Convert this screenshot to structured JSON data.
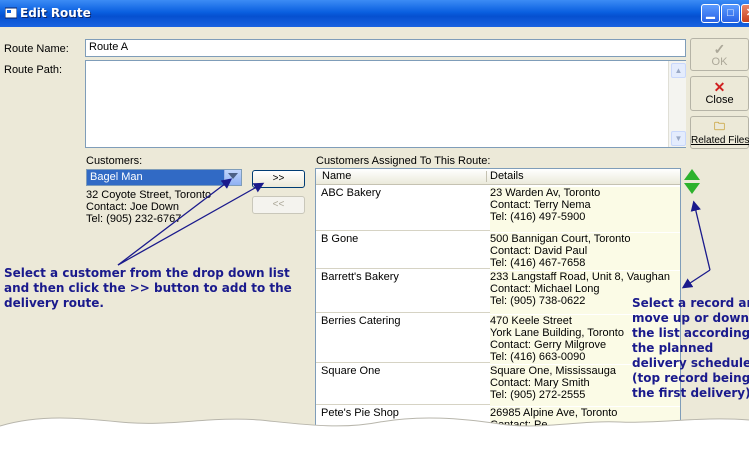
{
  "window": {
    "title": "Edit Route"
  },
  "form": {
    "route_name_label": "Route Name:",
    "route_name_value": "Route A",
    "route_path_label": "Route Path:",
    "route_path_value": ""
  },
  "side_buttons": {
    "ok": "OK",
    "close": "Close",
    "related_files": "Related Files"
  },
  "customers": {
    "label": "Customers:",
    "selected": "Bagel Man",
    "address": "32 Coyote Street, Toronto",
    "contact": "Contact: Joe Down",
    "tel": "Tel: (905) 232-6767",
    "add_label": ">>",
    "remove_label": "<<"
  },
  "assigned": {
    "label": "Customers Assigned To This Route:",
    "columns": [
      "Name",
      "Details"
    ],
    "rows": [
      {
        "name": "ABC Bakery",
        "details": [
          "23 Warden Av, Toronto",
          "Contact: Terry Nema",
          "Tel: (416) 497-5900"
        ]
      },
      {
        "name": "B Gone",
        "details": [
          "500 Bannigan Court, Toronto",
          "Contact: David Paul",
          "Tel: (416) 467-7658"
        ]
      },
      {
        "name": "Barrett's Bakery",
        "details": [
          "233 Langstaff Road, Unit 8, Vaughan",
          "Contact: Michael Long",
          "Tel: (905) 738-0622"
        ]
      },
      {
        "name": "Berries Catering",
        "details": [
          "470 Keele Street",
          "York Lane Building, Toronto",
          "Contact: Gerry Milgrove",
          "Tel: (416) 663-0090"
        ]
      },
      {
        "name": "Square One",
        "details": [
          "Square One, Mississauga",
          "Contact: Mary Smith",
          "Tel: (905) 272-2555"
        ]
      },
      {
        "name": "Pete's Pie Shop",
        "details": [
          "26985 Alpine Ave, Toronto",
          "Contact: Pe"
        ]
      }
    ]
  },
  "callouts": {
    "left": [
      "Select a customer from the drop down list",
      "and then click the >> button to add to the",
      "delivery route."
    ],
    "right": [
      "Select a record and",
      "move up or down",
      "the list according to",
      "the planned",
      "delivery schedule",
      "(top record being",
      "the first delivery)."
    ]
  },
  "colors": {
    "titlebar": "#0a5fe0",
    "callout_text": "#1a1a8c",
    "arrow_green": "#2db22d",
    "combo_selected": "#316ac5"
  }
}
